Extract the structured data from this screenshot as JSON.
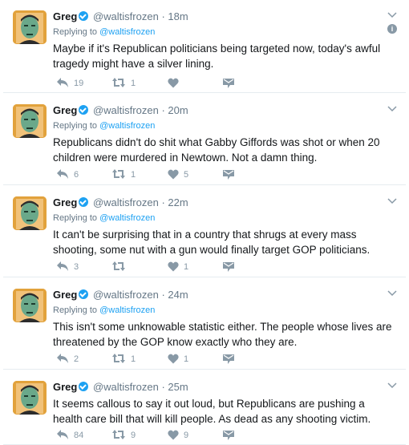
{
  "tweets": [
    {
      "name": "Greg",
      "handle": "@waltisfrozen",
      "dot": "·",
      "time": "18m",
      "replying_prefix": "Replying to",
      "replying_to": "@waltisfrozen",
      "text": "Maybe if it's Republican politicians being targeted now, today's awful tragedy might have a silver lining.",
      "replies": "19",
      "retweets": "1",
      "likes": "",
      "info_glyph": "i"
    },
    {
      "name": "Greg",
      "handle": "@waltisfrozen",
      "dot": "·",
      "time": "20m",
      "replying_prefix": "Replying to",
      "replying_to": "@waltisfrozen",
      "text": "Republicans didn't do shit what Gabby Giffords was shot or when 20 children were murdered in Newtown. Not a damn thing.",
      "replies": "6",
      "retweets": "1",
      "likes": "5"
    },
    {
      "name": "Greg",
      "handle": "@waltisfrozen",
      "dot": "·",
      "time": "22m",
      "replying_prefix": "Replying to",
      "replying_to": "@waltisfrozen",
      "text": "It can't be surprising that in a country that shrugs at every mass shooting, some nut with a gun would finally target GOP politicians.",
      "replies": "3",
      "retweets": "",
      "likes": "1"
    },
    {
      "name": "Greg",
      "handle": "@waltisfrozen",
      "dot": "·",
      "time": "24m",
      "replying_prefix": "Replying to",
      "replying_to": "@waltisfrozen",
      "text": "This isn't some unknowable statistic either. The people whose lives are threatened by the GOP know exactly who they are.",
      "replies": "2",
      "retweets": "1",
      "likes": "1"
    },
    {
      "name": "Greg",
      "handle": "@waltisfrozen",
      "dot": "·",
      "time": "25m",
      "replying_prefix": "",
      "replying_to": "",
      "text": "It seems callous to say it out loud, but Republicans are pushing a health care bill that will kill people. As dead as any shooting victim.",
      "replies": "84",
      "retweets": "9",
      "likes": "9"
    }
  ],
  "colors": {
    "accent": "#1da1f2",
    "muted": "#657786",
    "icon": "#8899a6",
    "divider": "#e6ecf0",
    "avatar_bg": "#e2a23c",
    "avatar_face": "#6aa88a"
  },
  "icons": {
    "reply": "reply-icon",
    "retweet": "retweet-icon",
    "like": "heart-icon",
    "dm": "direct-message-icon",
    "caret": "chevron-down-icon",
    "verified": "verified-badge-icon",
    "info": "info-icon"
  }
}
